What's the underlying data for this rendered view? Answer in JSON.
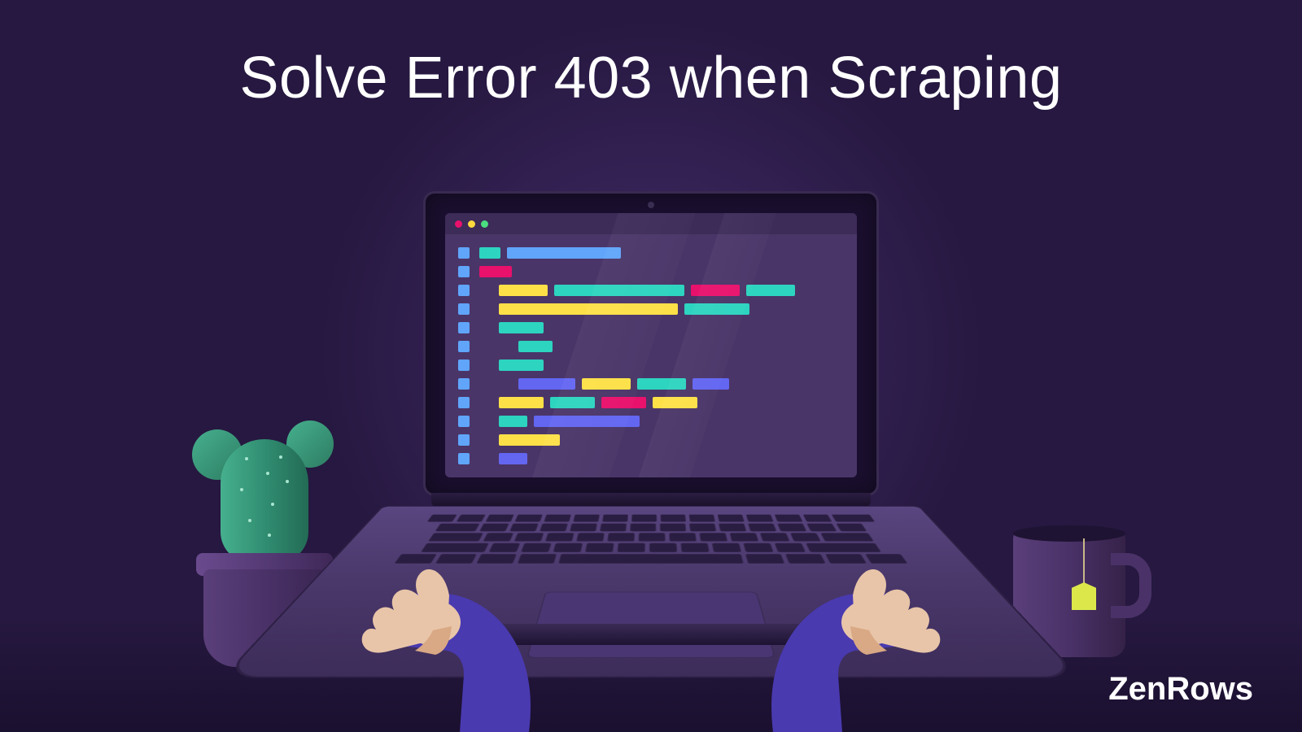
{
  "title": "Solve Error 403 when Scraping",
  "brand": "ZenRows",
  "colors": {
    "background": "#261840",
    "cactus": "#2f8a6e",
    "teabag": "#dce84a"
  },
  "illustration": {
    "object_left": "cactus-in-pot",
    "object_center": "laptop-with-code",
    "object_right": "mug-with-teabag",
    "hands": "typing"
  },
  "code_editor": {
    "window_dots": [
      "red",
      "yellow",
      "green"
    ],
    "line_count": 12
  }
}
